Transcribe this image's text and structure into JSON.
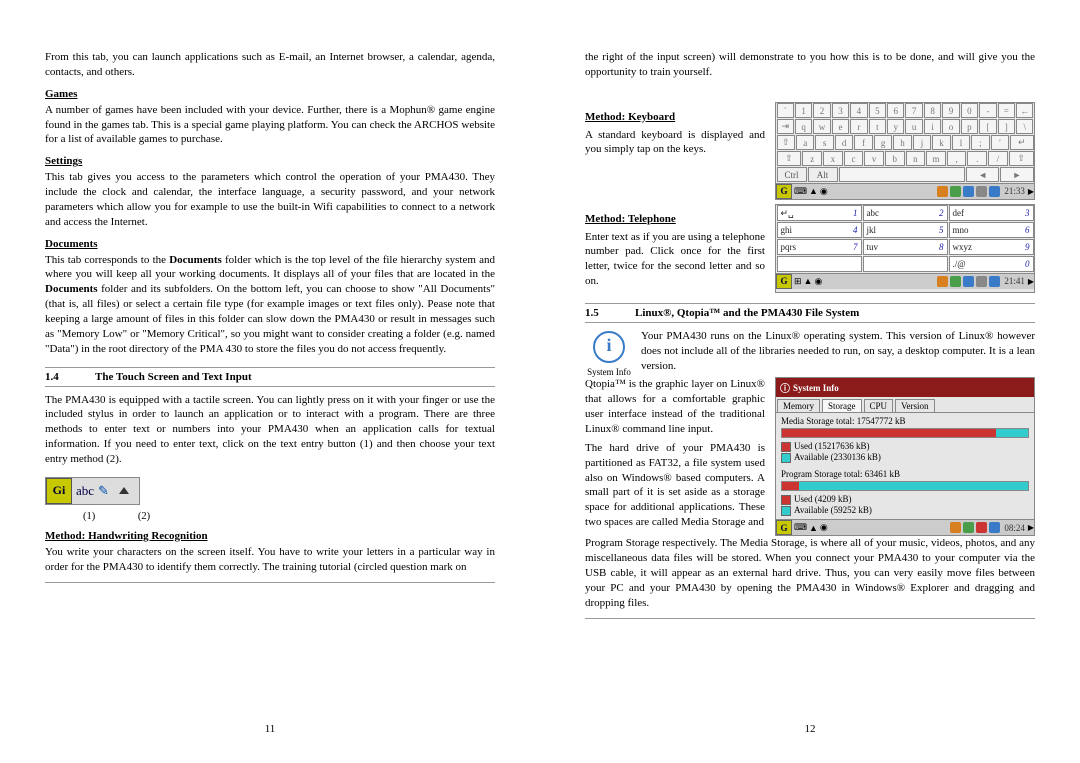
{
  "left": {
    "intro": "From this tab, you can launch applications such as E-mail, an Internet browser, a calendar, agenda, contacts, and others.",
    "h_games": "Games",
    "p_games": "A number of games have been included with your device. Further, there is a Mophun® game engine found in the games tab. This is a special game playing platform. You can check the ARCHOS website for a list of available games to purchase.",
    "h_settings": "Settings",
    "p_settings": "This tab gives you access to the parameters which control the operation of your PMA430. They include the clock and calendar, the interface language, a security password, and your network parameters which allow you for example to use the built-in Wifi capabilities to connect to a network and access the Internet.",
    "h_docs": "Documents",
    "p_docs": "This tab corresponds to the Documents folder which is the top level of the file hierarchy system and where you will keep all your working documents. It displays all of your files that are located in the Documents folder and its subfolders. On the bottom left, you can choose to show \"All Documents\" (that is, all files) or select a certain file type (for example images or text files only). Pease note that keeping a large amount of files in this folder can slow down the PMA430 or result in messages such as \"Memory Low\" or \"Memory Critical\", so you might want to consider creating a folder (e.g. named \"Data\") in the root directory of the PMA 430 to store the files you do not access frequently.",
    "sec_num": "1.4",
    "sec_title": "The Touch Screen and Text Input",
    "p_touch": "The PMA430 is equipped with a tactile screen. You can lightly press on it with your finger or use the included stylus in order to launch an application or to interact with a program. There are three methods to enter text or numbers into your PMA430 when an application calls for textual information. If you need to enter text, click on the text entry button (1) and then choose your text entry method (2).",
    "gi": "Gi",
    "abc": "abc",
    "l1": "(1)",
    "l2": "(2)",
    "h_hand": "Method: Handwriting Recognition",
    "p_hand": "You write your characters on the screen itself. You have to write your letters in a particular way in order for the PMA430 to identify them correctly. The training tutorial (circled question mark on",
    "pagenum": "11"
  },
  "right": {
    "p_top": "the right of the input screen) will demonstrate to you how this is to be done, and will give you the opportunity to train yourself.",
    "h_kbd": "Method: Keyboard",
    "p_kbd": "A standard keyboard is displayed and you simply tap on the keys.",
    "kbd_r1": [
      "`",
      "1",
      "2",
      "3",
      "4",
      "5",
      "6",
      "7",
      "8",
      "9",
      "0",
      "-",
      "=",
      "←"
    ],
    "kbd_r2": [
      "⇥",
      "q",
      "w",
      "e",
      "r",
      "t",
      "y",
      "u",
      "i",
      "o",
      "p",
      "[",
      "]",
      "\\"
    ],
    "kbd_r3": [
      "⇧",
      "a",
      "s",
      "d",
      "f",
      "g",
      "h",
      "j",
      "k",
      "l",
      ";",
      "'",
      "↵"
    ],
    "kbd_r4": [
      "⇧",
      "z",
      "x",
      "c",
      "v",
      "b",
      "n",
      "m",
      ",",
      ".",
      "/",
      "⇧"
    ],
    "kbd_r5_ctrl": "Ctrl",
    "kbd_r5_alt": "Alt",
    "clock1": "21:33",
    "h_tel": "Method: Telephone",
    "p_tel": "Enter text as if you are using a telephone number pad. Click once for the first letter, twice for the second letter and so on.",
    "tel": [
      [
        "↵␣",
        "1",
        "abc",
        "2",
        "def",
        "3"
      ],
      [
        "ghi",
        "4",
        "jkl",
        "5",
        "mno",
        "6"
      ],
      [
        "pqrs",
        "7",
        "tuv",
        "8",
        "wxyz",
        "9"
      ],
      [
        "",
        "",
        "",
        "",
        "./@",
        "0"
      ]
    ],
    "clock2": "21:41",
    "sec_num": "1.5",
    "sec_title": "Linux®, Qtopia™ and the PMA430 File System",
    "info_label": "System Info",
    "p_linux1": "Your PMA430 runs on the Linux® operating system. This version of Linux® however does not include all of the libraries needed to run, on say, a desktop computer. It is a lean version.",
    "p_linux2": "Qtopia™ is the graphic layer on Linux® that allows for a comfortable graphic user interface instead of the traditional Linux® command line input.",
    "p_linux3": "The hard drive of your PMA430 is partitioned as FAT32, a file system used also on Windows® based computers. A small part of it is set aside as a storage space for additional applications. These two spaces are called Media Storage and",
    "sys_title": "System Info",
    "tabs": [
      "Memory",
      "Storage",
      "CPU",
      "Version"
    ],
    "media_total": "Media Storage total: 17547772 kB",
    "media_used": "Used (15217636 kB)",
    "media_avail": "Available (2330136 kB)",
    "prog_total": "Program Storage total: 63461 kB",
    "prog_used": "Used (4209 kB)",
    "prog_avail": "Available (59252 kB)",
    "clock3": "08:24",
    "p_bottom": "Program Storage respectively. The Media Storage, is where all of your music, videos, photos, and any miscellaneous data files will be stored. When you connect your PMA430 to your computer via the USB cable, it will appear as an external hard drive. Thus, you can very easily move files between your PC and your PMA430 by opening the PMA430 in Windows® Explorer and dragging and dropping files.",
    "pagenum": "12"
  },
  "chart_data": {
    "type": "bar",
    "title": "System Info — Storage",
    "series": [
      {
        "name": "Media Storage",
        "total_kb": 17547772,
        "used_kb": 15217636,
        "available_kb": 2330136
      },
      {
        "name": "Program Storage",
        "total_kb": 63461,
        "used_kb": 4209,
        "available_kb": 59252
      }
    ]
  }
}
